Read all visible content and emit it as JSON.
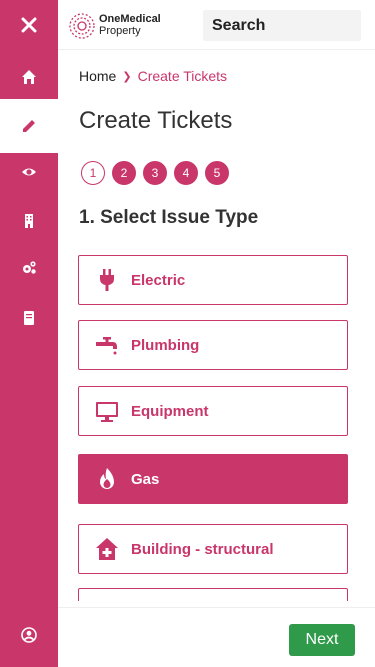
{
  "brand": {
    "name_line1": "OneMedical",
    "name_line2": "Property",
    "accent": "#c8366a",
    "success": "#2e9a4a"
  },
  "sidebar": {
    "items": [
      {
        "icon": "close-icon"
      },
      {
        "icon": "home-icon"
      },
      {
        "icon": "pencil-icon",
        "active": true
      },
      {
        "icon": "eye-icon"
      },
      {
        "icon": "building-icon"
      },
      {
        "icon": "gears-icon"
      },
      {
        "icon": "book-icon"
      },
      {
        "icon": "user-circle-icon"
      }
    ]
  },
  "search": {
    "label": "Search"
  },
  "breadcrumb": {
    "home": "Home",
    "current": "Create Tickets"
  },
  "page": {
    "title": "Create Tickets"
  },
  "steps": [
    "1",
    "2",
    "3",
    "4",
    "5"
  ],
  "section": {
    "title": "1. Select Issue Type"
  },
  "issues": [
    {
      "label": "Electric",
      "icon": "plug-icon"
    },
    {
      "label": "Plumbing",
      "icon": "faucet-icon"
    },
    {
      "label": "Equipment",
      "icon": "monitor-icon"
    },
    {
      "label": "Gas",
      "icon": "flame-icon",
      "selected": true
    },
    {
      "label": "Building - structural",
      "icon": "house-medical-icon"
    }
  ],
  "footer": {
    "next_label": "Next"
  }
}
